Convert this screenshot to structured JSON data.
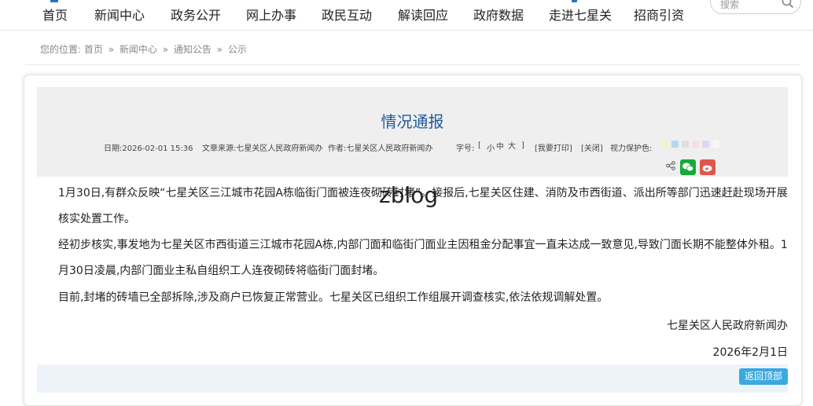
{
  "nav": {
    "items": [
      "首页",
      "新闻中心",
      "政务公开",
      "网上办事",
      "政民互动",
      "解读回应",
      "政府数据",
      "走进七星关",
      "招商引资"
    ],
    "search_placeholder": "搜索"
  },
  "breadcrumb": {
    "prefix": "您的位置:",
    "items": [
      "首页",
      "新闻中心",
      "通知公告",
      "公示"
    ],
    "separator": "»"
  },
  "article": {
    "title": "情况通报",
    "meta": {
      "date": "日期:2026-02-01 15:36",
      "source": "文章来源:七星关区人民政府新闻办",
      "author": "作者:七星关区人民政府新闻办",
      "font_label": "字号:",
      "bracket_open": "[",
      "font_small": "小",
      "font_medium": "中",
      "font_large": "大",
      "bracket_close": "]",
      "print": "[我要打印]",
      "close": "[关闭]",
      "eye_label": "视力保护色:"
    },
    "eye_colors": [
      "#f5f4c8",
      "#b4d9f0",
      "#e0e0e0",
      "#f5e0e0",
      "#e2d6f2",
      "#f8f8f8"
    ],
    "paragraphs": [
      "1月30日,有群众反映“七星关区三江城市花园A栋临街门面被连夜砌砖封堵”。接报后,七星关区住建、消防及市西街道、派出所等部门迅速赶赴现场开展核实处置工作。",
      "经初步核实,事发地为七星关区市西街道三江城市花园A栋,内部门面和临街门面业主因租金分配事宜一直未达成一致意见,导致门面长期不能整体外租。1月30日凌晨,内部门面业主私自组织工人连夜砌砖将临街门面封堵。",
      "目前,封堵的砖墙已全部拆除,涉及商户已恢复正常营业。七星关区已组织工作组展开调查核实,依法依规调解处置。"
    ],
    "signature": "七星关区人民政府新闻办",
    "sign_date": "2026年2月1日"
  },
  "watermark": "zblog",
  "back_to_top": "返回顶部",
  "colors": {
    "title": "#1f5a9a",
    "accent": "#3aa9e0",
    "nav_icon": "#2a72c0"
  }
}
